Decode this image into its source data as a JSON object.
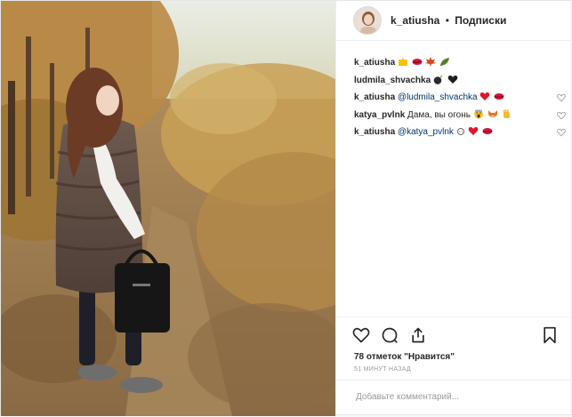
{
  "post": {
    "username": "k_atiusha",
    "separator": "•",
    "follow_label": "Подписки"
  },
  "comments": [
    {
      "user": "k_atiusha",
      "text": "",
      "emojis": [
        "crown-emoji",
        "lips-emoji",
        "maple-leaf-emoji",
        "fallen-leaf-emoji"
      ],
      "liked": false
    },
    {
      "user": "ludmila_shvachka",
      "text": "",
      "emojis": [
        "bomb-emoji",
        "black-heart-emoji"
      ],
      "liked": false
    },
    {
      "user": "k_atiusha",
      "mention": "@ludmila_shvachka",
      "text": "",
      "emojis": [
        "red-heart-emoji",
        "lips-emoji"
      ],
      "liked": false
    },
    {
      "user": "katya_pvlnk",
      "text": "Дама, вы огонь",
      "emojis": [
        "screaming-face-emoji",
        "fox-emoji",
        "raised-hand-emoji"
      ],
      "liked": false
    },
    {
      "user": "k_atiusha",
      "mention": "@katya_pvlnk",
      "text": "",
      "emojis": [
        "sleepy-face-emoji",
        "red-heart-emoji",
        "lips-emoji"
      ],
      "liked": false
    }
  ],
  "likes_label": "78 отметок \"Нравится\"",
  "timestamp": "51 МИНУТ НАЗАД",
  "comment_placeholder": "Добавьте комментарий...",
  "colors": {
    "mention": "#003569",
    "border": "#efefef",
    "muted": "#999999"
  }
}
